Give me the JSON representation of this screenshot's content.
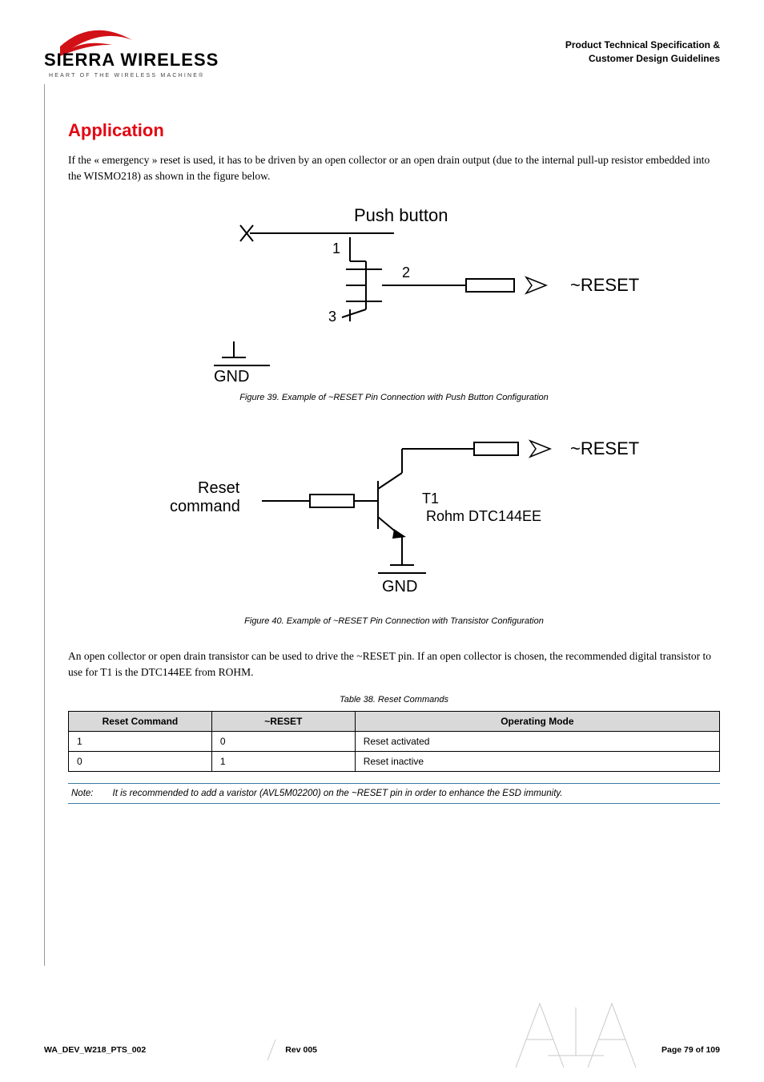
{
  "header": {
    "right_line1": "Product Technical Specification &",
    "right_line2": "Customer Design Guidelines",
    "logo_brand": "SIERRA WIRELESS",
    "logo_tagline": "HEART OF THE WIRELESS MACHINE®"
  },
  "section": {
    "title": "Application",
    "para1": "If the « emergency » reset is used, it has to be driven by an open collector or an open drain output (due to the internal pull-up resistor embedded into the WISMO218) as shown in the figure below."
  },
  "fig39": {
    "label_push": "Push button",
    "pin1": "1",
    "pin2": "2",
    "pin3": "3",
    "gnd": "GND",
    "reset": "~RESET",
    "caption": "Figure 39. Example of ~RESET Pin Connection with Push Button Configuration"
  },
  "fig40": {
    "reset_cmd_l1": "Reset",
    "reset_cmd_l2": "command",
    "t1": "T1",
    "rohm": "Rohm DTC144EE",
    "reset": "~RESET",
    "gnd": "GND",
    "caption": "Figure 40. Example of ~RESET Pin Connection with Transistor Configuration"
  },
  "para2": "An open collector or open drain transistor can be used to drive the ~RESET pin. If an open collector is chosen, the recommended digital transistor to use for T1 is the DTC144EE from ROHM.",
  "table": {
    "caption": "Table 38.    Reset Commands",
    "headers": [
      "Reset Command",
      "~RESET",
      "Operating Mode"
    ],
    "rows": [
      [
        "1",
        "0",
        "Reset activated"
      ],
      [
        "0",
        "1",
        "Reset inactive"
      ]
    ]
  },
  "note": {
    "label": "Note:",
    "text": "It is recommended to add a varistor (AVL5M02200) on the ~RESET pin in order to enhance the ESD immunity."
  },
  "footer": {
    "left": "WA_DEV_W218_PTS_002",
    "mid": "Rev 005",
    "right": "Page 79 of 109"
  }
}
